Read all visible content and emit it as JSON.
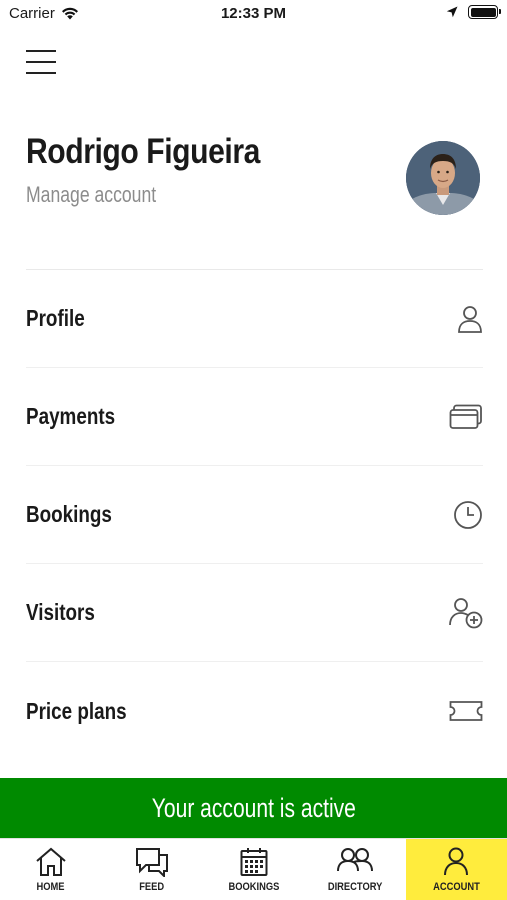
{
  "status_bar": {
    "carrier": "Carrier",
    "time": "12:33 PM"
  },
  "profile": {
    "name": "Rodrigo Figueira",
    "manage_label": "Manage account"
  },
  "menu": {
    "items": [
      {
        "label": "Profile",
        "icon": "person-icon"
      },
      {
        "label": "Payments",
        "icon": "cards-icon"
      },
      {
        "label": "Bookings",
        "icon": "clock-icon"
      },
      {
        "label": "Visitors",
        "icon": "add-person-icon"
      },
      {
        "label": "Price plans",
        "icon": "ticket-icon"
      }
    ]
  },
  "banner": {
    "text": "Your account is active",
    "color": "#008a00"
  },
  "tabs": [
    {
      "label": "HOME",
      "icon": "home-icon"
    },
    {
      "label": "FEED",
      "icon": "chat-icon"
    },
    {
      "label": "BOOKINGS",
      "icon": "calendar-icon"
    },
    {
      "label": "DIRECTORY",
      "icon": "people-icon"
    },
    {
      "label": "ACCOUNT",
      "icon": "person-icon",
      "active": true
    }
  ],
  "colors": {
    "accent_tab": "#ffec3d",
    "banner": "#008a00"
  }
}
